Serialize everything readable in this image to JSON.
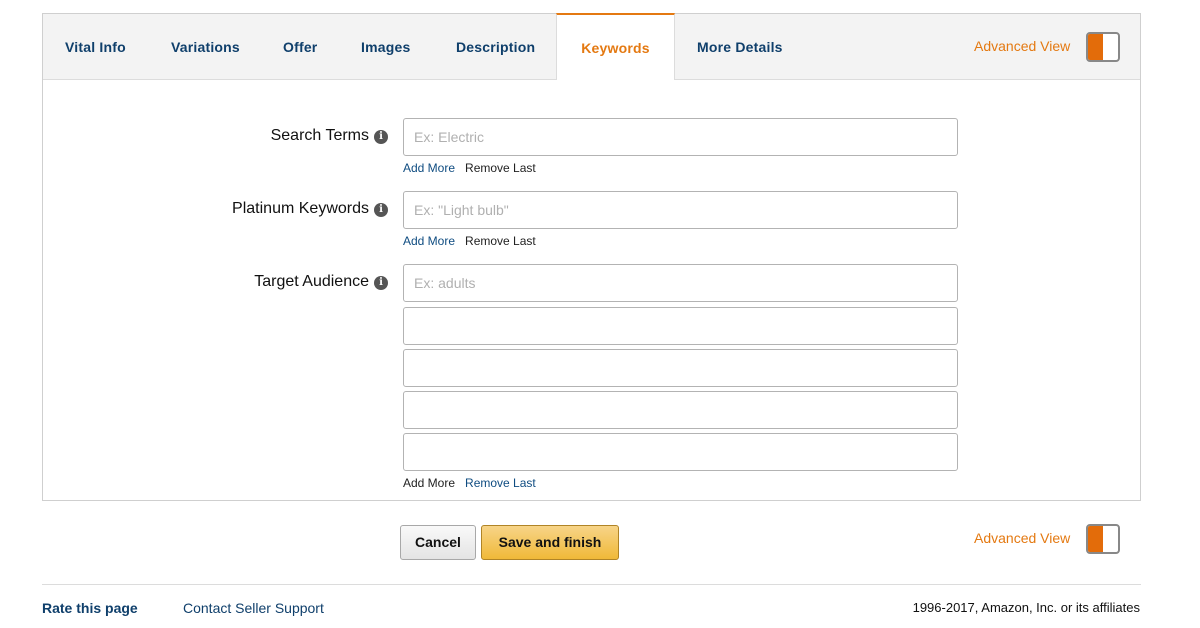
{
  "tabs": [
    {
      "label": "Vital Info"
    },
    {
      "label": "Variations"
    },
    {
      "label": "Offer"
    },
    {
      "label": "Images"
    },
    {
      "label": "Description"
    },
    {
      "label": "Keywords",
      "active": true
    },
    {
      "label": "More Details"
    }
  ],
  "advanced_view_label": "Advanced View",
  "form": {
    "search_terms": {
      "label": "Search Terms",
      "placeholder": "Ex: Electric",
      "add_more": "Add More",
      "remove_last": "Remove Last"
    },
    "platinum_keywords": {
      "label": "Platinum Keywords",
      "placeholder": "Ex: \"Light bulb\"",
      "add_more": "Add More",
      "remove_last": "Remove Last"
    },
    "target_audience": {
      "label": "Target Audience",
      "placeholder": "Ex: adults",
      "add_more": "Add More",
      "remove_last": "Remove Last"
    }
  },
  "actions": {
    "cancel": "Cancel",
    "save": "Save and finish"
  },
  "footer": {
    "rate": "Rate this page",
    "support": "Contact Seller Support",
    "copyright": "1996-2017, Amazon, Inc. or its affiliates"
  },
  "colors": {
    "accent": "#e47911",
    "link": "#0f3f6b",
    "save_button": "#f0b938"
  },
  "icons": {
    "info": "info-icon",
    "toggle": "advanced-view-toggle"
  }
}
